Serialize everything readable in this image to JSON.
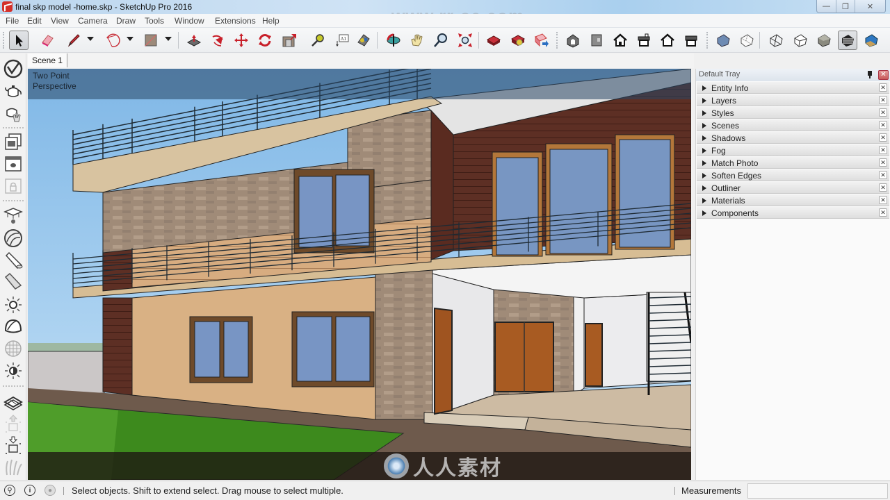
{
  "window": {
    "title": "final skp model -home.skp - SketchUp Pro 2016",
    "watermark": "www.rr-sc.com",
    "controls": {
      "minimize": "—",
      "restore": "❐",
      "close": "✕"
    }
  },
  "menu": [
    "File",
    "Edit",
    "View",
    "Camera",
    "Draw",
    "Tools",
    "Window",
    "Extensions",
    "Help"
  ],
  "toolbar": {
    "tools": [
      {
        "name": "select",
        "icon": "arrow-cursor-icon",
        "active": true
      },
      {
        "name": "eraser",
        "icon": "eraser-icon"
      },
      {
        "name": "line",
        "icon": "pencil-icon",
        "dropdown": true
      },
      {
        "name": "arc",
        "icon": "arc-icon",
        "dropdown": true
      },
      {
        "name": "rectangle",
        "icon": "rectangle-icon",
        "dropdown": true
      },
      {
        "name": "push-pull",
        "icon": "push-pull-icon"
      },
      {
        "name": "follow-me",
        "icon": "follow-me-icon"
      },
      {
        "name": "move",
        "icon": "move-icon"
      },
      {
        "name": "rotate",
        "icon": "rotate-icon"
      },
      {
        "name": "offset",
        "icon": "offset-icon"
      },
      {
        "name": "tape-measure",
        "icon": "tape-measure-icon"
      },
      {
        "name": "text",
        "icon": "text-label-icon",
        "label": "A1"
      },
      {
        "name": "paint-bucket",
        "icon": "paint-bucket-icon"
      },
      {
        "name": "orbit",
        "icon": "orbit-icon"
      },
      {
        "name": "pan",
        "icon": "pan-hand-icon"
      },
      {
        "name": "zoom",
        "icon": "zoom-magnifier-icon"
      },
      {
        "name": "zoom-extents",
        "icon": "zoom-extents-icon"
      },
      {
        "name": "3d-warehouse",
        "icon": "warehouse-icon"
      },
      {
        "name": "extension-warehouse",
        "icon": "extension-warehouse-icon"
      },
      {
        "name": "share-model",
        "icon": "share-model-icon"
      },
      {
        "name": "iso-view",
        "icon": "iso-view-icon"
      },
      {
        "name": "top-view",
        "icon": "top-view-icon"
      },
      {
        "name": "front-view",
        "icon": "front-view-icon"
      },
      {
        "name": "right-view",
        "icon": "right-view-icon"
      },
      {
        "name": "back-view",
        "icon": "back-view-icon"
      },
      {
        "name": "left-view",
        "icon": "left-view-icon"
      },
      {
        "name": "x-ray",
        "icon": "xray-style-icon"
      },
      {
        "name": "back-edges",
        "icon": "back-edges-style-icon"
      },
      {
        "name": "wireframe",
        "icon": "wireframe-style-icon"
      },
      {
        "name": "hidden-line",
        "icon": "hidden-line-style-icon"
      },
      {
        "name": "shaded",
        "icon": "shaded-style-icon"
      },
      {
        "name": "shaded-textures",
        "icon": "shaded-textures-style-icon",
        "active": true
      },
      {
        "name": "monochrome",
        "icon": "monochrome-style-icon"
      }
    ]
  },
  "scenes": {
    "tabs": [
      "Scene 1"
    ],
    "active": "Scene 1"
  },
  "left_toolbar": [
    "sketchup-logo-icon",
    "teapot-icon",
    "teapot-hand-icon",
    "layers-stack-icon",
    "window-teapot-icon",
    "lock-window-icon",
    "graduation-cap-icon",
    "sphere-icon",
    "spotlight-icon",
    "paint-cone-icon",
    "sun-icon",
    "dome-icon",
    "globe-grid-icon",
    "half-sun-icon",
    "sandbox-icon",
    "upload-box-icon",
    "download-box-icon",
    "grass-icon"
  ],
  "viewport": {
    "camera_label_line1": "Two Point",
    "camera_label_line2": "Perspective",
    "watermark_text": "人人素材",
    "colors": {
      "sky": "#9ec9ee",
      "wall_light": "#d9b184",
      "wall_dark": "#5c2e22",
      "stone": "#a38e7c",
      "glass": "#7a95c0",
      "door": "#a5581e",
      "grass": "#3f8a1f",
      "floor": "#c9b79f"
    }
  },
  "tray": {
    "title": "Default Tray",
    "panels": [
      "Entity Info",
      "Layers",
      "Styles",
      "Scenes",
      "Shadows",
      "Fog",
      "Match Photo",
      "Soften Edges",
      "Outliner",
      "Materials",
      "Components"
    ]
  },
  "statusbar": {
    "icons": [
      "geo-location-icon",
      "credits-info-icon",
      "user-account-icon"
    ],
    "message": "Select objects. Shift to extend select. Drag mouse to select multiple.",
    "measurements_label": "Measurements",
    "measurements_value": ""
  }
}
